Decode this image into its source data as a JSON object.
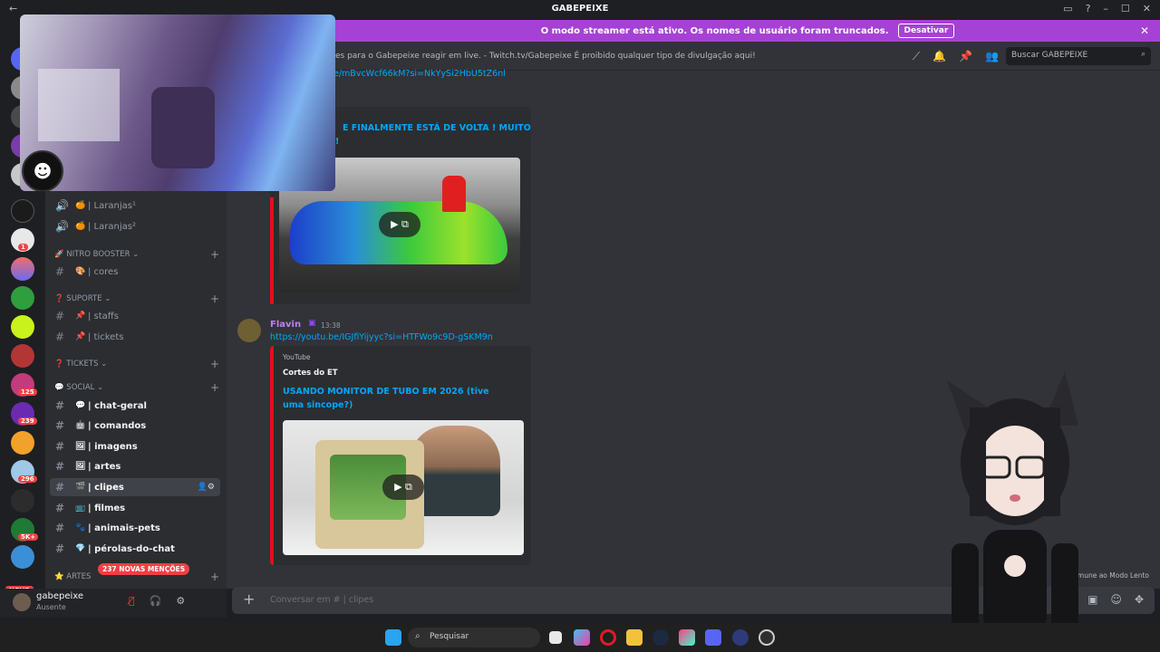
{
  "window": {
    "title": "GABEPEIXE",
    "back": "←",
    "controls": [
      "▭",
      "?",
      "–",
      "☐",
      "✕"
    ]
  },
  "banner": {
    "text": "O modo streamer está ativo. Os nomes de usuário foram truncados.",
    "button": "Desativar",
    "close": "✕"
  },
  "topbar": {
    "topic": "es para o Gabepeixe reagir em live. - Twitch.tv/Gabepeixe É proibido qualquer tipo de divulgação aqui!",
    "search_placeholder": "Buscar GABEPEIXE"
  },
  "servers": {
    "badges": [
      "1",
      "125",
      "239",
      "296",
      "5K+"
    ],
    "novo": "NOVO"
  },
  "channels": {
    "items": [
      {
        "label": "| Laranjas¹",
        "emoji": "🍊"
      },
      {
        "label": "| Laranjas²",
        "emoji": "🍊"
      },
      {
        "label": "| cores",
        "emoji": "🎨"
      },
      {
        "label": "| staffs",
        "emoji": "📌"
      },
      {
        "label": "| tickets",
        "emoji": "📌"
      },
      {
        "label": "| chat-geral",
        "emoji": "💬"
      },
      {
        "label": "| comandos",
        "emoji": "🤖"
      },
      {
        "label": "| imagens",
        "emoji": "🖼"
      },
      {
        "label": "| artes",
        "emoji": "🖼"
      },
      {
        "label": "| clipes",
        "emoji": "🎬"
      },
      {
        "label": "| filmes",
        "emoji": "📺"
      },
      {
        "label": "| animais-pets",
        "emoji": "🐾"
      },
      {
        "label": "| pérolas-do-chat",
        "emoji": "💎"
      }
    ],
    "categories": [
      "NITRO BOOSTER",
      "SUPORTE",
      "TICKETS",
      "SOCIAL",
      "ARTES"
    ],
    "mentions": "237 NOVAS MENÇÕES"
  },
  "user": {
    "name": "gabepeixe",
    "status": "Ausente"
  },
  "chat": {
    "top_link": "e/mBvcWcf66kM?si=NkYySi2HbU5tZ6nl",
    "first_embed_title": "E FINALMENTE ESTÁ DE VOLTA ! MUITO",
    "first_embed_title2": "!",
    "message": {
      "author": "Flavin",
      "time": "13:38",
      "link": "https://youtu.be/IGJfiYijyyc?si=HTFWo9c9D-gSKM9n"
    },
    "embed": {
      "provider": "YouTube",
      "author": "Cortes do ET",
      "title": "USANDO MONITOR DE TUBO EM 2026 (tive uma sincope?)"
    },
    "slow_mode": "Imune ao Modo Lento"
  },
  "composer": {
    "placeholder": "Conversar em #  | clipes"
  },
  "taskbar": {
    "search": "Pesquisar"
  }
}
